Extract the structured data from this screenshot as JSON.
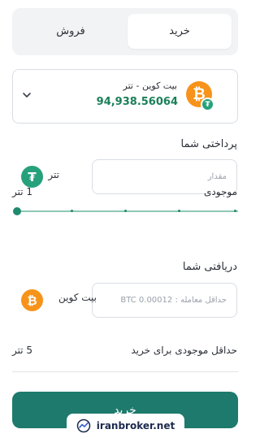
{
  "tabs": {
    "buy": "خرید",
    "sell": "فروش"
  },
  "selected_pair": {
    "name": "بیت کوین - تتر",
    "price": "94,938.56064"
  },
  "pay": {
    "label": "پرداختی شما",
    "placeholder": "مقدار",
    "asset": "تتر"
  },
  "balance": {
    "label": "موجودی",
    "value": "1 تتر"
  },
  "receive": {
    "label": "دریافتی شما",
    "placeholder": "حداقل معامله : BTC 0.00012",
    "asset": "بیت کوین"
  },
  "min_balance": {
    "label": "حداقل موجودی برای خرید",
    "value": "5 تتر"
  },
  "submit": {
    "label": "خرید"
  },
  "watermark": {
    "text": "iranbroker.net"
  },
  "colors": {
    "accent": "#1d7a6c",
    "price": "#1a7f5a",
    "btc": "#f7931a",
    "usdt": "#26a17b"
  },
  "icons": {
    "chevron": "chevron-down-icon",
    "btc": "bitcoin-icon",
    "usdt": "tether-icon",
    "logo": "iranbroker-logo-icon"
  }
}
